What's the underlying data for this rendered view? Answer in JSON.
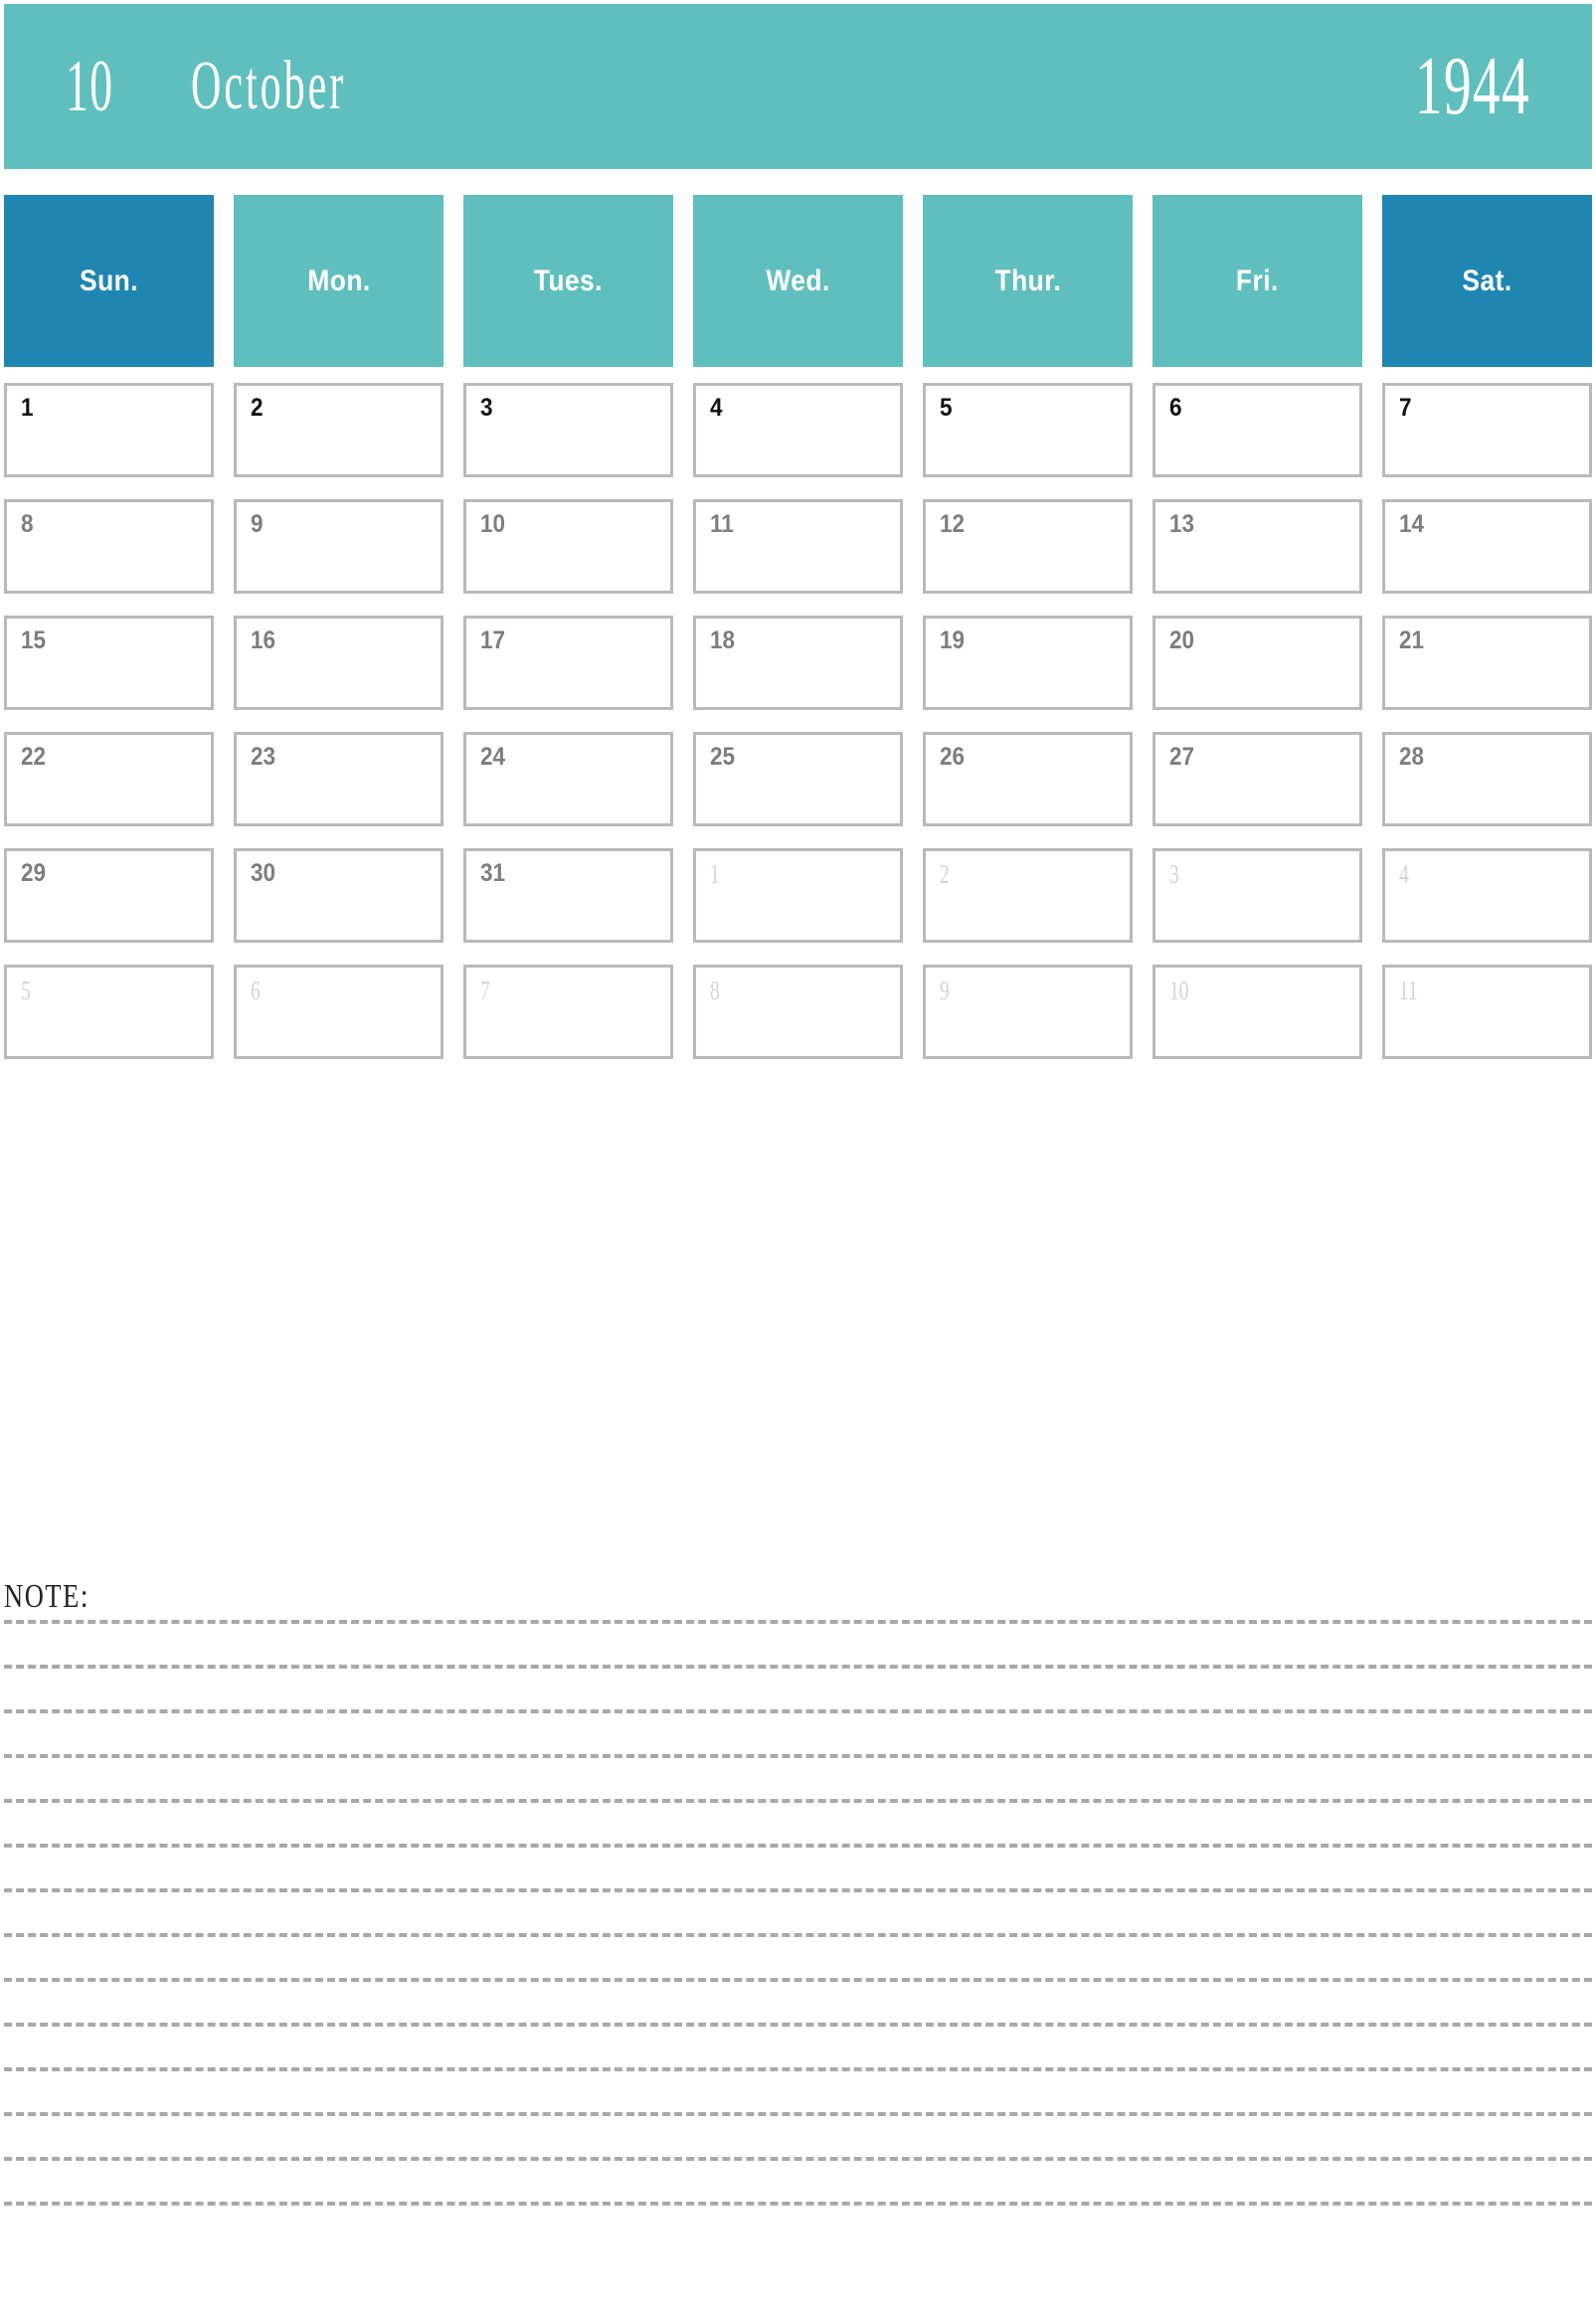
{
  "title": {
    "month_number": "10",
    "month_name": "October",
    "year": "1944"
  },
  "colors": {
    "header_teal": "#5FBFBF",
    "weekend_blue": "#1E86B0",
    "cell_border": "#b9b9b9",
    "in_month_text": "#7d7d7d",
    "first_week_text": "#111111",
    "other_month_text": "#d3d3d3",
    "note_rule": "#a8a8a8"
  },
  "weekdays": [
    {
      "label": "Sun.",
      "weekend": true
    },
    {
      "label": "Mon.",
      "weekend": false
    },
    {
      "label": "Tues.",
      "weekend": false
    },
    {
      "label": "Wed.",
      "weekend": false
    },
    {
      "label": "Thur.",
      "weekend": false
    },
    {
      "label": "Fri.",
      "weekend": false
    },
    {
      "label": "Sat.",
      "weekend": true
    }
  ],
  "weeks": [
    [
      {
        "day": "1",
        "current_month": true
      },
      {
        "day": "2",
        "current_month": true
      },
      {
        "day": "3",
        "current_month": true
      },
      {
        "day": "4",
        "current_month": true
      },
      {
        "day": "5",
        "current_month": true
      },
      {
        "day": "6",
        "current_month": true
      },
      {
        "day": "7",
        "current_month": true
      }
    ],
    [
      {
        "day": "8",
        "current_month": true
      },
      {
        "day": "9",
        "current_month": true
      },
      {
        "day": "10",
        "current_month": true
      },
      {
        "day": "11",
        "current_month": true
      },
      {
        "day": "12",
        "current_month": true
      },
      {
        "day": "13",
        "current_month": true
      },
      {
        "day": "14",
        "current_month": true
      }
    ],
    [
      {
        "day": "15",
        "current_month": true
      },
      {
        "day": "16",
        "current_month": true
      },
      {
        "day": "17",
        "current_month": true
      },
      {
        "day": "18",
        "current_month": true
      },
      {
        "day": "19",
        "current_month": true
      },
      {
        "day": "20",
        "current_month": true
      },
      {
        "day": "21",
        "current_month": true
      }
    ],
    [
      {
        "day": "22",
        "current_month": true
      },
      {
        "day": "23",
        "current_month": true
      },
      {
        "day": "24",
        "current_month": true
      },
      {
        "day": "25",
        "current_month": true
      },
      {
        "day": "26",
        "current_month": true
      },
      {
        "day": "27",
        "current_month": true
      },
      {
        "day": "28",
        "current_month": true
      }
    ],
    [
      {
        "day": "29",
        "current_month": true
      },
      {
        "day": "30",
        "current_month": true
      },
      {
        "day": "31",
        "current_month": true
      },
      {
        "day": "1",
        "current_month": false
      },
      {
        "day": "2",
        "current_month": false
      },
      {
        "day": "3",
        "current_month": false
      },
      {
        "day": "4",
        "current_month": false
      }
    ],
    [
      {
        "day": "5",
        "current_month": false
      },
      {
        "day": "6",
        "current_month": false
      },
      {
        "day": "7",
        "current_month": false
      },
      {
        "day": "8",
        "current_month": false
      },
      {
        "day": "9",
        "current_month": false
      },
      {
        "day": "10",
        "current_month": false
      },
      {
        "day": "11",
        "current_month": false
      }
    ]
  ],
  "note": {
    "label": "NOTE:",
    "line_count": 14
  }
}
